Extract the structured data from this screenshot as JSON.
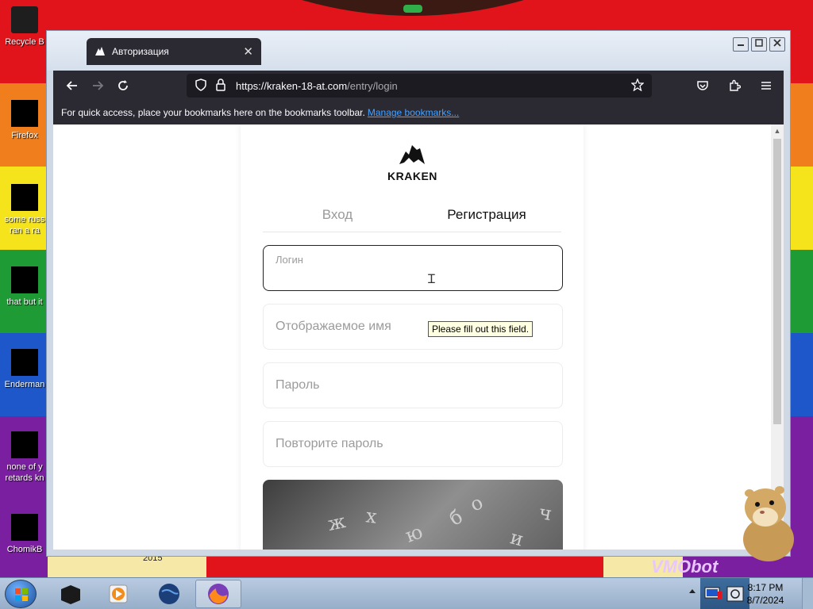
{
  "desktop": {
    "icons": [
      {
        "label": "Recycle B"
      },
      {
        "label": "Firefox"
      },
      {
        "label": "some russ\nran a ra"
      },
      {
        "label": "that but it"
      },
      {
        "label": "Enderman"
      },
      {
        "label": "none of y\nretards kn"
      },
      {
        "label": "ChomikB"
      }
    ],
    "wallpaper_caption": "VMObot",
    "wallpaper_year": "2015"
  },
  "browser": {
    "tab_title": "Авторизация",
    "tab_close": "✕",
    "url_host": "https://kraken-18-at.com",
    "url_path": "/entry/login",
    "bookmarks_text": "For quick access, place your bookmarks here on the bookmarks toolbar.",
    "bookmarks_link": "Manage bookmarks..."
  },
  "page": {
    "logo_text": "KRAKEN",
    "tabs": {
      "login": "Вход",
      "register": "Регистрация"
    },
    "fields": {
      "login": "Логин",
      "display_name": "Отображаемое имя",
      "password": "Пароль",
      "repeat_password": "Повторите пароль"
    },
    "tooltip": "Please fill out this field.",
    "captcha_letters": [
      "ж",
      "х",
      "ю",
      "б",
      "о",
      "ч",
      "и"
    ]
  },
  "taskbar": {
    "time": "8:17 PM",
    "date": "8/7/2024"
  },
  "colors": {
    "browser_chrome": "#2b2a33",
    "link": "#45a1ff",
    "tooltip_bg": "#ffffe1"
  }
}
